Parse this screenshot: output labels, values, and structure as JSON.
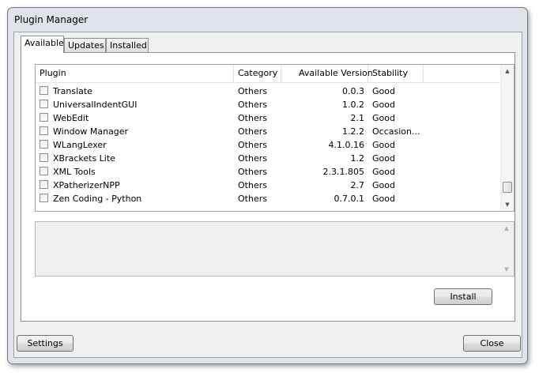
{
  "window": {
    "title": "Plugin Manager"
  },
  "tabs": [
    {
      "label": "Available",
      "active": true
    },
    {
      "label": "Updates",
      "active": false
    },
    {
      "label": "Installed",
      "active": false
    }
  ],
  "list": {
    "columns": [
      "Plugin",
      "Category",
      "Available Version",
      "Stability"
    ],
    "rows": [
      {
        "checked": false,
        "plugin": "Translate",
        "category": "Others",
        "version": "0.0.3",
        "stability": "Good"
      },
      {
        "checked": false,
        "plugin": "UniversalIndentGUI",
        "category": "Others",
        "version": "1.0.2",
        "stability": "Good"
      },
      {
        "checked": false,
        "plugin": "WebEdit",
        "category": "Others",
        "version": "2.1",
        "stability": "Good"
      },
      {
        "checked": false,
        "plugin": "Window Manager",
        "category": "Others",
        "version": "1.2.2",
        "stability": "Occasion..."
      },
      {
        "checked": false,
        "plugin": "WLangLexer",
        "category": "Others",
        "version": "4.1.0.16",
        "stability": "Good"
      },
      {
        "checked": false,
        "plugin": "XBrackets Lite",
        "category": "Others",
        "version": "1.2",
        "stability": "Good"
      },
      {
        "checked": false,
        "plugin": "XML Tools",
        "category": "Others",
        "version": "2.3.1.805",
        "stability": "Good"
      },
      {
        "checked": false,
        "plugin": "XPatherizerNPP",
        "category": "Others",
        "version": "2.7",
        "stability": "Good"
      },
      {
        "checked": false,
        "plugin": "Zen Coding - Python",
        "category": "Others",
        "version": "0.7.0.1",
        "stability": "Good"
      }
    ],
    "scroll_position": 0.95
  },
  "description": {
    "text": ""
  },
  "buttons": {
    "install": "Install",
    "settings": "Settings",
    "close": "Close"
  },
  "icons": {
    "scroll_up": "chevron-up-icon",
    "scroll_down": "chevron-down-icon"
  }
}
